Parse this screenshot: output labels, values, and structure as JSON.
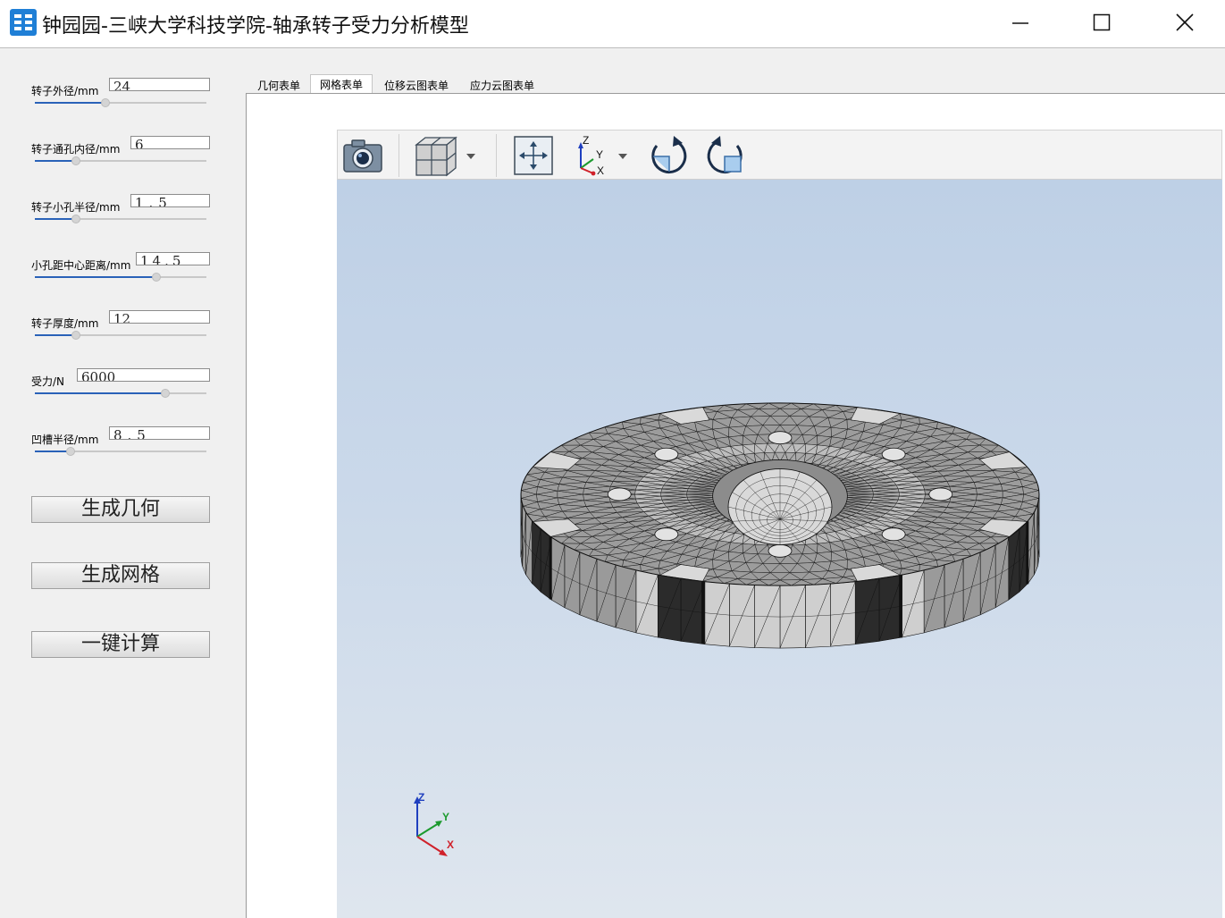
{
  "window": {
    "title": "钟园园-三峡大学科技学院-轴承转子受力分析模型",
    "app_icon": "app-logo-icon",
    "controls": [
      "minimize-icon",
      "maximize-icon",
      "close-icon"
    ]
  },
  "params": [
    {
      "label": "转子外径/mm",
      "value": "24",
      "slider_fraction": 0.41
    },
    {
      "label": "转子通孔内径/mm",
      "value": "6",
      "slider_fraction": 0.24
    },
    {
      "label": "转子小孔半径/mm",
      "value": "1.5",
      "slider_fraction": 0.24
    },
    {
      "label": "小孔距中心距离/mm",
      "value": "14.5",
      "slider_fraction": 0.71
    },
    {
      "label": "转子厚度/mm",
      "value": "12",
      "slider_fraction": 0.24
    },
    {
      "label": "受力/N",
      "value": "6000",
      "slider_fraction": 0.76
    },
    {
      "label": "凹槽半径/mm",
      "value": "8.5",
      "slider_fraction": 0.21
    }
  ],
  "buttons": {
    "generate_geometry": "生成几何",
    "generate_mesh": "生成网格",
    "compute": "一键计算"
  },
  "tabs": [
    {
      "label": "几何表单",
      "active": false
    },
    {
      "label": "网格表单",
      "active": true
    },
    {
      "label": "位移云图表单",
      "active": false
    },
    {
      "label": "应力云图表单",
      "active": false
    }
  ],
  "toolbar": {
    "icons": [
      "camera-icon",
      "view-cube-icon",
      "fit-all-icon",
      "axes-orientation-icon",
      "rotate-cw-icon",
      "rotate-ccw-icon"
    ],
    "axis_labels": {
      "z": "Z",
      "y": "Y",
      "x": "X"
    }
  },
  "viewport": {
    "model": "meshed-rotor",
    "triad_labels": {
      "z": "Z",
      "y": "Y",
      "x": "X"
    },
    "colors": {
      "mesh_dark": "#8f8f8f",
      "mesh_light": "#d8d8d8",
      "edge": "#111111",
      "bg_top": "#bed0e6",
      "bg_bottom": "#dfe6ee"
    }
  }
}
